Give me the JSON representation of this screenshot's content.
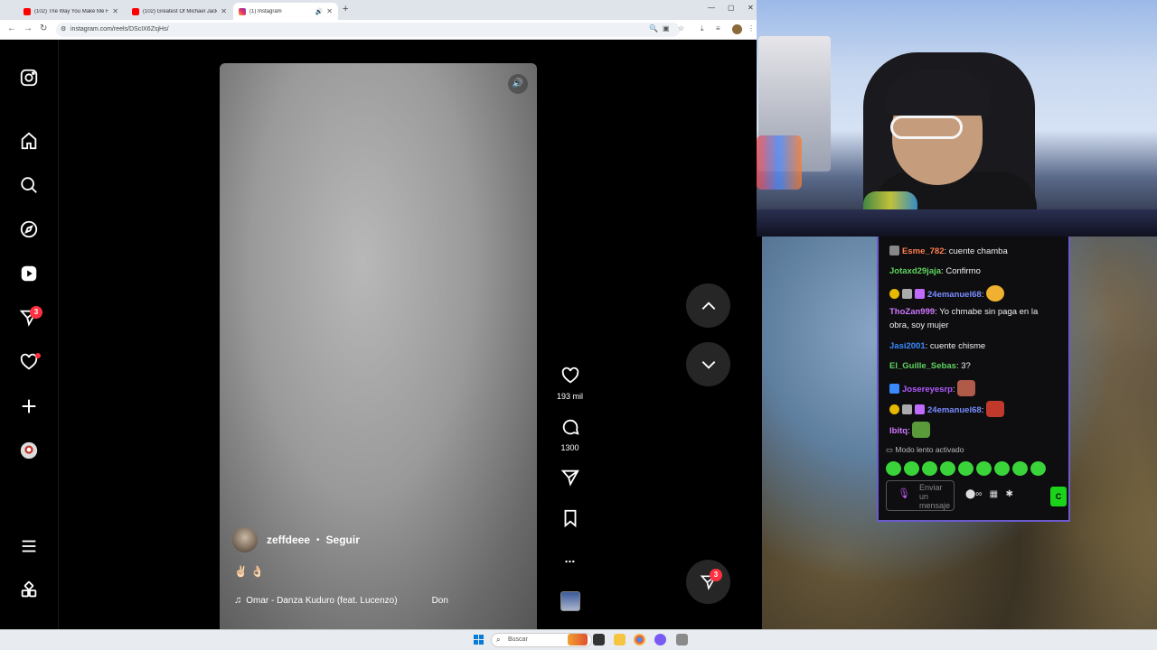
{
  "browser": {
    "tabs": [
      {
        "title": "(102) The Way You Make Me Fe",
        "icon": "youtube-icon",
        "active": false
      },
      {
        "title": "(102) Greatest Of Michael Jackso",
        "icon": "youtube-icon",
        "active": false
      },
      {
        "title": "(1) Instagram",
        "icon": "instagram-icon",
        "active": true
      }
    ],
    "url": "instagram.com/reels/DScIX6ZsjHs/"
  },
  "sidebar": {
    "messages_badge": "3"
  },
  "reel": {
    "username": "zeffdeee",
    "separator": "•",
    "follow_label": "Seguir",
    "caption": "✌🏻 👌🏻",
    "audio_title": "Omar - Danza Kuduro (feat. Lucenzo)",
    "audio_extra": "Don"
  },
  "actions": {
    "likes": "193 mil",
    "comments": "1300",
    "more": "..."
  },
  "floating_messages_badge": "3",
  "chat": {
    "messages": [
      {
        "user": "Esme_782",
        "text": "cuente chamba",
        "color": "#ff7f50"
      },
      {
        "user": "Jotaxd29jaja",
        "text": "Confirmo",
        "color": "#5fd35f"
      },
      {
        "user": "24emanuel68",
        "text": "",
        "color": "#7a8cff"
      },
      {
        "user": "ThoZan999",
        "text": "Yo chmabe sin paga en la",
        "text2": "obra, soy mujer",
        "color": "#d078ff"
      },
      {
        "user": "Jasi2001",
        "text": "cuente chisme",
        "color": "#3a8aff"
      },
      {
        "user": "El_Guille_Sebas",
        "text": "3?",
        "color": "#5fd35f"
      },
      {
        "user": "Josereyesrp",
        "text": "",
        "color": "#b25aff"
      },
      {
        "user": "24emanuel68",
        "text": "",
        "color": "#7a8cff"
      },
      {
        "user": "lbitq",
        "text": "",
        "color": "#d078ff"
      }
    ],
    "slow_mode": "Modo lento activado",
    "input_placeholder": "Enviar un mensaje",
    "send_label": "C"
  },
  "taskbar": {
    "search_placeholder": "Buscar"
  },
  "colors": {
    "instagram_bg": "#000000",
    "notification_red": "#ff3040",
    "chat_border": "#6a5acd"
  }
}
